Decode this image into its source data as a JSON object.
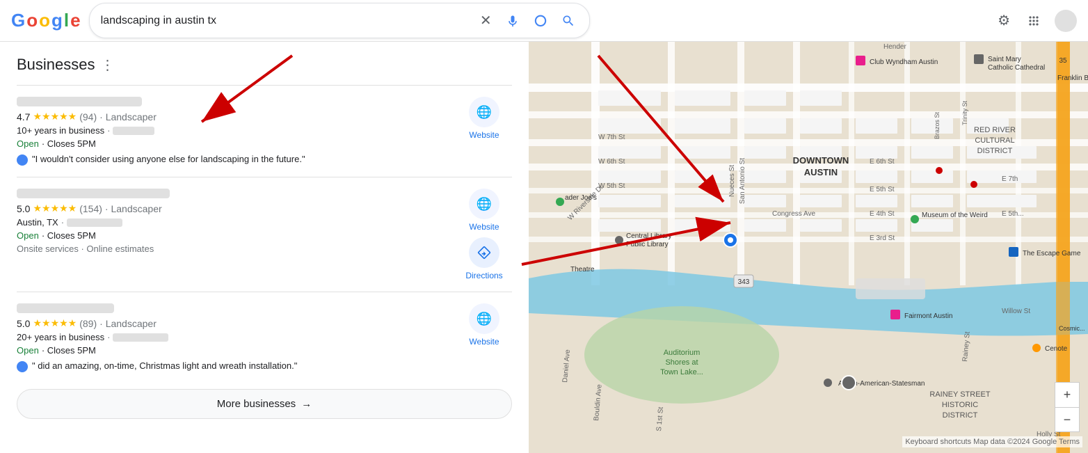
{
  "header": {
    "logo_letters": [
      "G",
      "o",
      "o",
      "g",
      "l",
      "e"
    ],
    "search_value": "landscaping in austin tx",
    "clear_btn": "×",
    "settings_tooltip": "Settings",
    "apps_tooltip": "Google apps"
  },
  "businesses_section": {
    "title": "Businesses",
    "more_icon": "⋮",
    "businesses": [
      {
        "rating": "4.7",
        "stars": "★★★★★",
        "review_count": "(94)",
        "category": "· Landscaper",
        "detail1": "10+ years in business",
        "open": "Open",
        "closes": "· Closes 5PM",
        "review_text": "\"I wouldn't consider using anyone else for landscaping in the future.\"",
        "actions": [
          "Website"
        ]
      },
      {
        "rating": "5.0",
        "stars": "★★★★★",
        "review_count": "(154)",
        "category": "· Landscaper",
        "location": "Austin, TX",
        "open": "Open",
        "closes": "· Closes 5PM",
        "services": "Onsite services · Online estimates",
        "actions": [
          "Website",
          "Directions"
        ]
      },
      {
        "rating": "5.0",
        "stars": "★★★★★",
        "review_count": "(89)",
        "category": "· Landscaper",
        "detail1": "20+ years in business",
        "open": "Open",
        "closes": "· Closes 5PM",
        "review_text": "\" did an amazing, on-time, Christmas light and wreath installation.\"",
        "actions": [
          "Website"
        ]
      }
    ],
    "more_btn": "More businesses",
    "more_arrow": "→"
  },
  "map": {
    "zoom_in": "+",
    "zoom_out": "−",
    "attribution": "Keyboard shortcuts  Map data ©2024 Google  Terms",
    "labels": {
      "downtown": "DOWNTOWN\nAUSTIN",
      "red_river": "RED RIVER\nCULTURAL\nDISTRICT",
      "rainey": "RAINEY STREET\nHISTORIC\nDISTRICT",
      "auditorium": "Auditorium\nShores at\nTown Lake...",
      "congress": "Congress Ave",
      "museum_weird": "Museum of the Weird",
      "escape_game": "The Escape Game",
      "fairmont": "Fairmont Austin",
      "club_wyndham": "Club Wyndham Austin",
      "saint_mary": "Saint Mary\nCatholic Cathedral",
      "franklin": "Franklin Barbe...",
      "austin_statesman": "Austin-American-Statesman"
    }
  },
  "icons": {
    "mic": "🎤",
    "camera": "🔍",
    "search": "🔍",
    "clear": "✕",
    "settings": "⚙",
    "apps": "⋮⋮⋮",
    "website": "🌐",
    "directions": "➤",
    "globe_blue": "🌐"
  }
}
